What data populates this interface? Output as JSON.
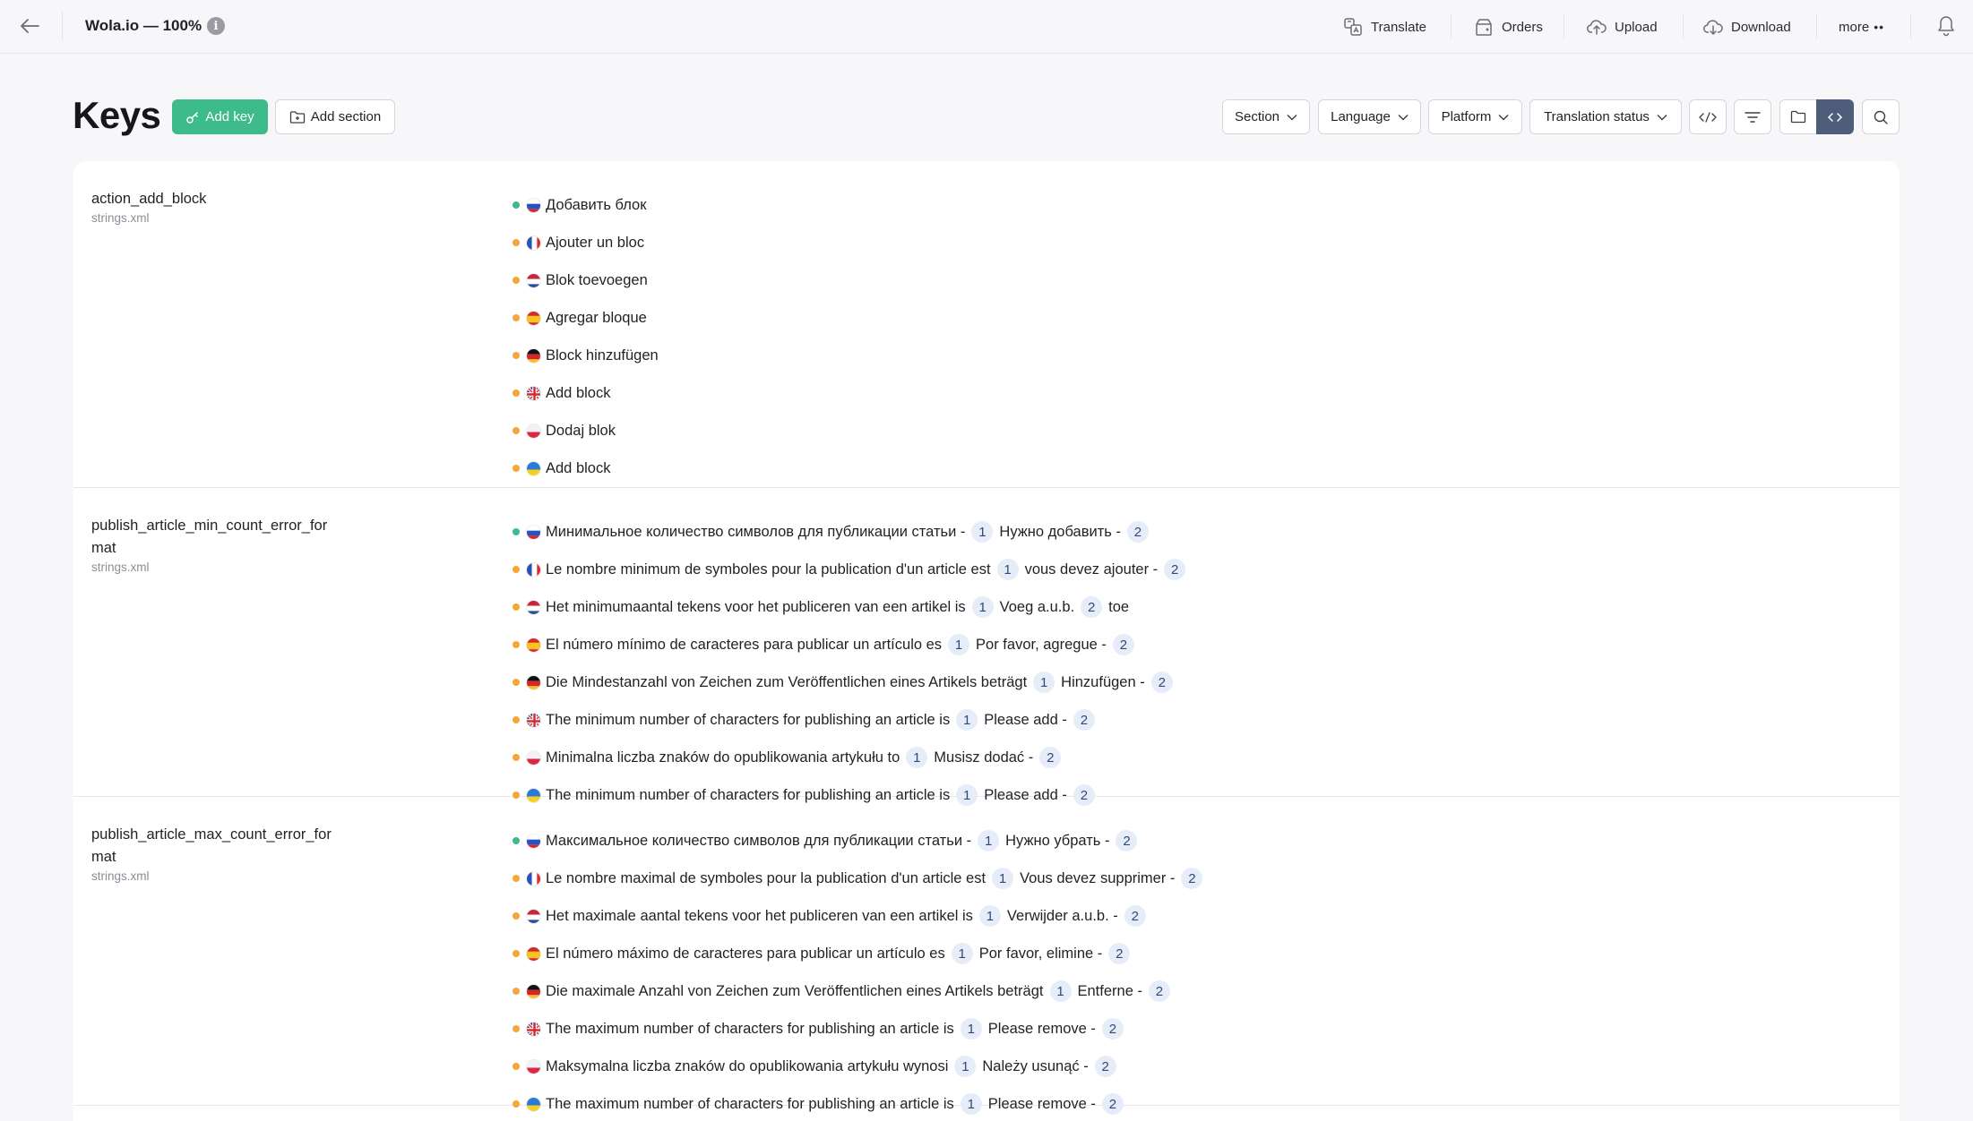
{
  "topbar": {
    "title": "Wola.io — 100%",
    "actions": {
      "translate": "Translate",
      "orders": "Orders",
      "upload": "Upload",
      "download": "Download",
      "more": "more"
    }
  },
  "header": {
    "title": "Keys",
    "add_key": "Add key",
    "add_section": "Add section",
    "filters": {
      "section": "Section",
      "language": "Language",
      "platform": "Platform",
      "translation_status": "Translation status"
    }
  },
  "colors": {
    "accent_green": "#3dbb8b",
    "pending_orange": "#f3a73b",
    "active_view": "#4f5d7a",
    "placeholder_bg": "#e6edf8"
  },
  "keys": [
    {
      "name": "action_add_block",
      "file": "strings.xml",
      "translations": [
        {
          "lang": "ru",
          "status": "done",
          "parts": [
            "Добавить блок"
          ]
        },
        {
          "lang": "fr",
          "status": "pending",
          "parts": [
            "Ajouter un bloc"
          ]
        },
        {
          "lang": "nl",
          "status": "pending",
          "parts": [
            "Blok toevoegen"
          ]
        },
        {
          "lang": "es",
          "status": "pending",
          "parts": [
            "Agregar bloque"
          ]
        },
        {
          "lang": "de",
          "status": "pending",
          "parts": [
            "Block hinzufügen"
          ]
        },
        {
          "lang": "gb",
          "status": "pending",
          "parts": [
            "Add block"
          ]
        },
        {
          "lang": "pl",
          "status": "pending",
          "parts": [
            "Dodaj blok"
          ]
        },
        {
          "lang": "ua",
          "status": "pending",
          "parts": [
            "Add block"
          ]
        }
      ]
    },
    {
      "name": "publish_article_min_count_error_format",
      "file": "strings.xml",
      "translations": [
        {
          "lang": "ru",
          "status": "done",
          "parts": [
            "Минимальное количество символов для публикации статьи -",
            "1",
            "Нужно добавить -",
            "2"
          ]
        },
        {
          "lang": "fr",
          "status": "pending",
          "parts": [
            "Le nombre minimum de symboles pour la publication d'un article est",
            "1",
            "vous devez ajouter -",
            "2"
          ]
        },
        {
          "lang": "nl",
          "status": "pending",
          "parts": [
            "Het minimumaantal tekens voor het publiceren van een artikel is",
            "1",
            "Voeg a.u.b.",
            "2",
            "toe"
          ]
        },
        {
          "lang": "es",
          "status": "pending",
          "parts": [
            "El número mínimo de caracteres para publicar un artículo es",
            "1",
            "Por favor, agregue -",
            "2"
          ]
        },
        {
          "lang": "de",
          "status": "pending",
          "parts": [
            "Die Mindestanzahl von Zeichen zum Veröffentlichen eines Artikels beträgt",
            "1",
            "Hinzufügen -",
            "2"
          ]
        },
        {
          "lang": "gb",
          "status": "pending",
          "parts": [
            "The minimum number of characters for publishing an article is",
            "1",
            "Please add -",
            "2"
          ]
        },
        {
          "lang": "pl",
          "status": "pending",
          "parts": [
            "Minimalna liczba znaków do opublikowania artykułu to",
            "1",
            "Musisz dodać -",
            "2"
          ]
        },
        {
          "lang": "ua",
          "status": "pending",
          "parts": [
            "The minimum number of characters for publishing an article is",
            "1",
            "Please add -",
            "2"
          ]
        }
      ]
    },
    {
      "name": "publish_article_max_count_error_format",
      "file": "strings.xml",
      "translations": [
        {
          "lang": "ru",
          "status": "done",
          "parts": [
            "Максимальное количество символов для публикации статьи -",
            "1",
            "Нужно убрать -",
            "2"
          ]
        },
        {
          "lang": "fr",
          "status": "pending",
          "parts": [
            "Le nombre maximal de symboles pour la publication d'un article est",
            "1",
            "Vous devez supprimer -",
            "2"
          ]
        },
        {
          "lang": "nl",
          "status": "pending",
          "parts": [
            "Het maximale aantal tekens voor het publiceren van een artikel is",
            "1",
            "Verwijder a.u.b. -",
            "2"
          ]
        },
        {
          "lang": "es",
          "status": "pending",
          "parts": [
            "El número máximo de caracteres para publicar un artículo es",
            "1",
            "Por favor, elimine -",
            "2"
          ]
        },
        {
          "lang": "de",
          "status": "pending",
          "parts": [
            "Die maximale Anzahl von Zeichen zum Veröffentlichen eines Artikels beträgt",
            "1",
            "Entferne -",
            "2"
          ]
        },
        {
          "lang": "gb",
          "status": "pending",
          "parts": [
            "The maximum number of characters for publishing an article is",
            "1",
            "Please remove -",
            "2"
          ]
        },
        {
          "lang": "pl",
          "status": "pending",
          "parts": [
            "Maksymalna liczba znaków do opublikowania artykułu wynosi",
            "1",
            "Należy usunąć -",
            "2"
          ]
        },
        {
          "lang": "ua",
          "status": "pending",
          "parts": [
            "The maximum number of characters for publishing an article is",
            "1",
            "Please remove -",
            "2"
          ]
        }
      ]
    }
  ]
}
